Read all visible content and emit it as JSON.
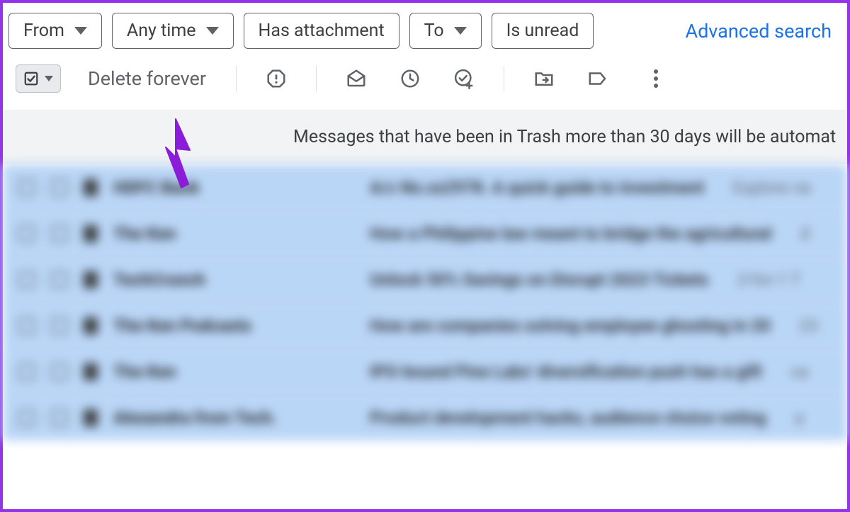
{
  "filters": {
    "from": "From",
    "any_time": "Any time",
    "has_attachment": "Has attachment",
    "to": "To",
    "is_unread": "Is unread",
    "advanced": "Advanced search"
  },
  "toolbar": {
    "delete_forever": "Delete forever"
  },
  "banner": {
    "text": "Messages that have been in Trash more than 30 days will be automat"
  },
  "emails": [
    {
      "sender": "HDFC Bank",
      "subject": "A/c No.xx2978. A quick guide to investment",
      "preview": "Explore ne"
    },
    {
      "sender": "The Ken",
      "subject": "How a Philippine law meant to bridge the agricultural",
      "preview": "d"
    },
    {
      "sender": "TechCrunch",
      "subject": "Unlock 50% Savings on Disrupt 2023 Tickets",
      "preview": "2-for-1 T"
    },
    {
      "sender": "The Ken Podcasts",
      "subject": "How are companies solving employee ghosting in 20",
      "preview": "23"
    },
    {
      "sender": "The Ken",
      "subject": "IPO-bound Pine Labs' diversification push has a gift",
      "preview": "ca"
    },
    {
      "sender": "Alexandra from Tech.",
      "subject": "Product development hacks, audience choice voting",
      "preview": "a"
    }
  ]
}
